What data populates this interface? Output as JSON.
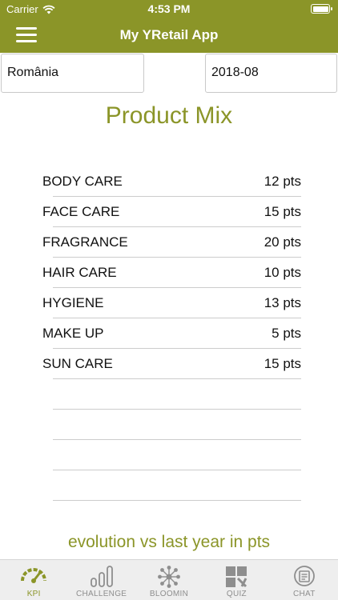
{
  "status_bar": {
    "carrier": "Carrier",
    "time": "4:53 PM"
  },
  "nav": {
    "title": "My YRetail App"
  },
  "filters": {
    "country": "România",
    "period": "2018-08"
  },
  "section_title": "Product Mix",
  "products": [
    {
      "name": "BODY CARE",
      "value": "12 pts"
    },
    {
      "name": "FACE CARE",
      "value": "15 pts"
    },
    {
      "name": "FRAGRANCE",
      "value": "20 pts"
    },
    {
      "name": "HAIR CARE",
      "value": "10 pts"
    },
    {
      "name": "HYGIENE",
      "value": "13 pts"
    },
    {
      "name": "MAKE UP",
      "value": "5 pts"
    },
    {
      "name": "SUN CARE",
      "value": "15 pts"
    }
  ],
  "evolution_title": "evolution vs last year in pts",
  "tabs": [
    {
      "label": "KPI",
      "icon": "gauge-icon",
      "active": true
    },
    {
      "label": "CHALLENGE",
      "icon": "bars-icon",
      "active": false
    },
    {
      "label": "BLOOMIN",
      "icon": "network-icon",
      "active": false
    },
    {
      "label": "QUIZ",
      "icon": "puzzle-icon",
      "active": false
    },
    {
      "label": "CHAT",
      "icon": "chat-icon",
      "active": false
    }
  ],
  "colors": {
    "brand": "#8b9528",
    "tab_inactive": "#8e8e8e"
  }
}
